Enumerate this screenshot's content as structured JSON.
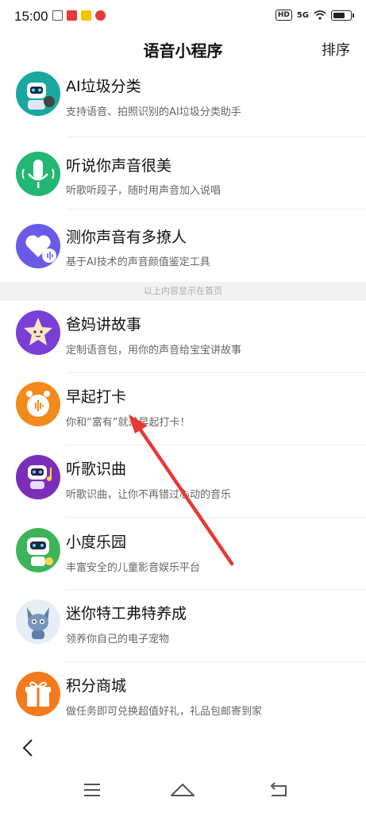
{
  "status_bar": {
    "time": "15:00",
    "hd": "HD",
    "net": "5G"
  },
  "header": {
    "title": "语音小程序",
    "sort": "排序"
  },
  "items_top": [
    {
      "name": "AI垃圾分类",
      "desc": "支持语音、拍照识别的AI垃圾分类助手",
      "icon": "robot-icon",
      "color": "#1aa7a0"
    },
    {
      "name": "听说你声音很美",
      "desc": "听歌听段子，随时用声音加入说唱",
      "icon": "microphone-icon",
      "color": "#22b774"
    },
    {
      "name": "测你声音有多撩人",
      "desc": "基于AI技术的声音颜值鉴定工具",
      "icon": "heart-icon",
      "color": "#6a5ae8"
    }
  ],
  "divider": "以上内容显示在首页",
  "items_bottom": [
    {
      "name": "爸妈讲故事",
      "desc": "定制语音包，用你的声音给宝宝讲故事",
      "icon": "star-face-icon",
      "color": "#7a3fd6"
    },
    {
      "name": "早起打卡",
      "desc": "你和“富有”就差早起打卡！",
      "icon": "alarm-clock-icon",
      "color": "#f28a1c"
    },
    {
      "name": "听歌识曲",
      "desc": "听歌识曲，让你不再错过心动的音乐",
      "icon": "music-robot-icon",
      "color": "#7b2fb8"
    },
    {
      "name": "小度乐园",
      "desc": "丰富安全的儿童影音娱乐平台",
      "icon": "xiaodu-robot-icon",
      "color": "#3cb45a"
    },
    {
      "name": "迷你特工弗特养成",
      "desc": "领养你自己的电子宠物",
      "icon": "pet-agent-icon",
      "color": "#5f7fa8"
    },
    {
      "name": "积分商城",
      "desc": "做任务即可兑换超值好礼，礼品包邮寄到家",
      "icon": "gift-icon",
      "color": "#f37b1d"
    }
  ]
}
